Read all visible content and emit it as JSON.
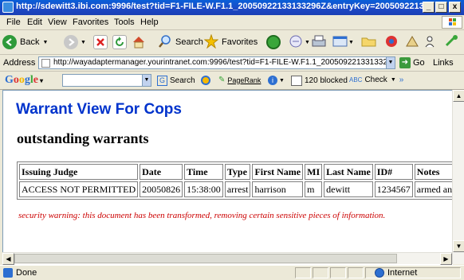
{
  "window": {
    "title": "http://sdewitt3.ibi.com:9996/test?tid=F1-FILE-W.F1.1_20050922133133296Z&entryKey=20050922133133 - Mic...",
    "controls": [
      "_",
      "□",
      "x"
    ]
  },
  "menu": [
    "File",
    "Edit",
    "View",
    "Favorites",
    "Tools",
    "Help"
  ],
  "toolbar": {
    "back_label": "Back",
    "search_label": "Search",
    "favorites_label": "Favorites"
  },
  "address": {
    "label": "Address",
    "url": "http://wayadaptermanager.yourintranet.com:9996/test?tid=F1-FILE-W.F1.1_20050922133133296Z&entr",
    "go_label": "Go",
    "links_label": "Links"
  },
  "googlebar": {
    "logo": "Google",
    "search_label": "Search",
    "pagerank_label": "PageRank",
    "blocked_label": "120 blocked",
    "check_label": "Check"
  },
  "page": {
    "heading": "Warrant View For Cops",
    "subheading": "outstanding warrants",
    "table": {
      "headers": [
        "Issuing Judge",
        "Date",
        "Time",
        "Type",
        "First Name",
        "MI",
        "Last Name",
        "ID#",
        "Notes"
      ],
      "rows": [
        [
          "ACCESS NOT PERMITTED",
          "20050826",
          "15:38:00",
          "arrest",
          "harrison",
          "m",
          "dewitt",
          "1234567",
          "armed and d"
        ]
      ]
    },
    "warning": "security warning: this document has been transformed, removing certain sensitive pieces of information."
  },
  "status": {
    "text": "Done",
    "zone": "Internet"
  },
  "colors": {
    "heading": "#0033cc",
    "warning": "#cc0000",
    "titlebar": "#1c48c4"
  }
}
